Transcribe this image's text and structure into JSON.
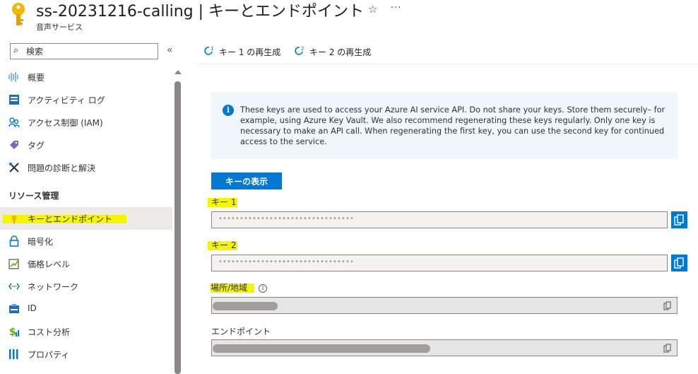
{
  "header": {
    "title": "ss-20231216-calling | キーとエンドポイント",
    "subtitle": "音声サービス",
    "star": "☆",
    "more": "···"
  },
  "sidebar": {
    "search_placeholder": "検索",
    "collapse": "«",
    "section_header": "リソース管理",
    "items": [
      {
        "label": "概要",
        "icon": "overview-icon"
      },
      {
        "label": "アクティビティ ログ",
        "icon": "activity-log-icon"
      },
      {
        "label": "アクセス制御 (IAM)",
        "icon": "people-icon"
      },
      {
        "label": "タグ",
        "icon": "tag-icon"
      },
      {
        "label": "問題の診断と解決",
        "icon": "wrench-icon"
      },
      {
        "label": "キーとエンドポイント",
        "icon": "key-icon",
        "selected": true
      },
      {
        "label": "暗号化",
        "icon": "lock-icon"
      },
      {
        "label": "価格レベル",
        "icon": "pricing-icon"
      },
      {
        "label": "ネットワーク",
        "icon": "network-icon"
      },
      {
        "label": "ID",
        "icon": "identity-icon"
      },
      {
        "label": "コスト分析",
        "icon": "cost-icon"
      },
      {
        "label": "プロパティ",
        "icon": "properties-icon"
      }
    ]
  },
  "toolbar": {
    "regen_key1": "キー 1 の再生成",
    "regen_key2": "キー 2 の再生成"
  },
  "info": {
    "text": "These keys are used to access your Azure AI service API. Do not share your keys. Store them securely– for example, using Azure Key Vault. We also recommend regenerating these keys regularly. Only one key is necessary to make an API call. When regenerating the first key, you can use the second key for continued access to the service."
  },
  "show_keys_button": "キーの表示",
  "fields": {
    "key1_label": "キー 1",
    "key1_value": "••••••••••••••••••••••••••••••••",
    "key2_label": "キー 2",
    "key2_value": "••••••••••••••••••••••••••••••••",
    "location_label": "場所/地域",
    "location_info": "i",
    "endpoint_label": "エンドポイント"
  },
  "colors": {
    "accent": "#0078d4",
    "highlight": "#f5f500",
    "key_gold": "#f2b700"
  }
}
